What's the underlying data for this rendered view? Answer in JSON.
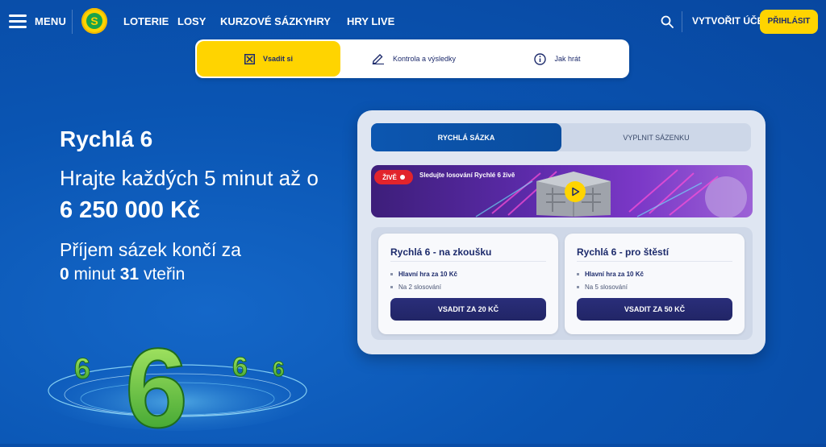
{
  "nav": {
    "menu_label": "MENU",
    "links": [
      "LOTERIE",
      "LOSY",
      "KURZOVÉ SÁZKY",
      "HRY",
      "HRY LIVE"
    ],
    "create_account": "VYTVOŘIT ÚČET",
    "login": "PŘIHLÁSIT",
    "logo_letter": "S"
  },
  "top_tabs": [
    "Vsadit si",
    "Kontrola a výsledky",
    "Jak hrát"
  ],
  "hero": {
    "title": "Rychlá 6",
    "subtitle": "Hrajte každých 5 minut až o",
    "prize": "6 250 000 Kč",
    "close_prefix": "Příjem sázek končí za",
    "minutes": "0",
    "minutes_word": "minut",
    "seconds": "31",
    "seconds_word": "vteřin"
  },
  "panel": {
    "seg_active": "RYCHLÁ SÁZKA",
    "seg_inactive": "VYPLNIT SÁZENKU",
    "live_badge": "ŽIVĚ",
    "banner_text": "Sledujte losování Rychlé 6 živě",
    "cards": [
      {
        "title": "Rychlá 6 - na zkoušku",
        "item1": "Hlavní hra za 10 Kč",
        "item2": "Na 2 slosování",
        "button": "VSADIT ZA 20 KČ"
      },
      {
        "title": "Rychlá 6 - pro štěstí",
        "item1": "Hlavní hra za 10 Kč",
        "item2": "Na 5 slosování",
        "button": "VSADIT ZA 50 KČ"
      }
    ]
  },
  "colors": {
    "accent_yellow": "#ffd400",
    "brand_blue": "#0a55b3",
    "button_navy": "#2a2e7a",
    "live_red": "#e2242c"
  }
}
